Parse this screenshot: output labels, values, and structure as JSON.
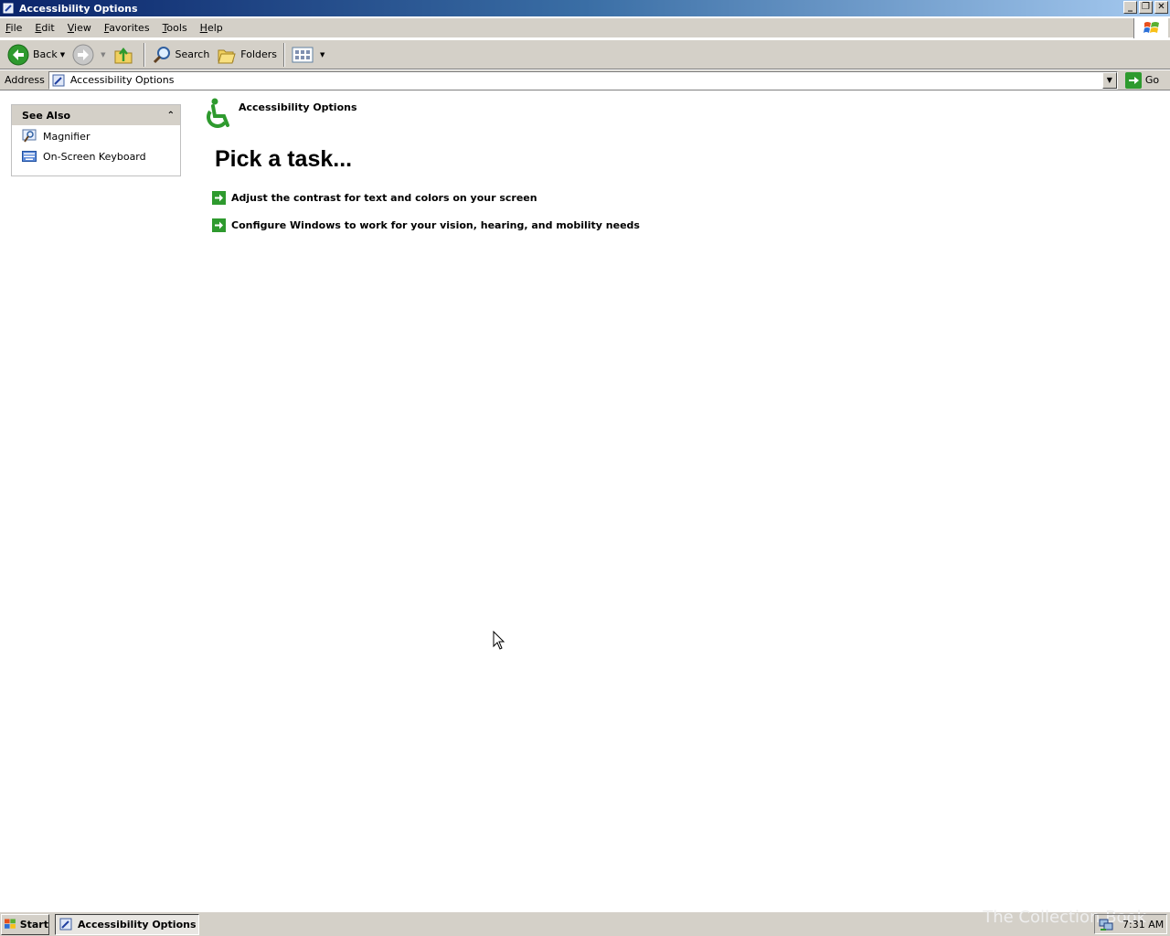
{
  "window": {
    "title": "Accessibility Options"
  },
  "menubar": {
    "items": [
      {
        "key": "F",
        "rest": "ile"
      },
      {
        "key": "E",
        "rest": "dit"
      },
      {
        "key": "V",
        "rest": "iew"
      },
      {
        "key": "F",
        "rest": "avorites",
        "prefix": ""
      },
      {
        "key": "T",
        "rest": "ools"
      },
      {
        "key": "H",
        "rest": "elp"
      }
    ]
  },
  "toolbar": {
    "back_label": "Back",
    "search_label": "Search",
    "folders_label": "Folders"
  },
  "address": {
    "label": "Address",
    "value": "Accessibility Options",
    "go_label": "Go"
  },
  "see_also": {
    "title": "See Also",
    "items": [
      {
        "label": "Magnifier"
      },
      {
        "label": "On-Screen Keyboard"
      }
    ]
  },
  "main": {
    "category_title": "Accessibility Options",
    "pick_title": "Pick a task...",
    "tasks": [
      {
        "label": "Adjust the contrast for text and colors on your screen"
      },
      {
        "label": "Configure Windows to work for your vision, hearing, and mobility needs"
      }
    ]
  },
  "taskbar": {
    "start_label": "Start",
    "active_task": "Accessibility Options",
    "clock": "7:31 AM",
    "watermark": "The Collection Book"
  },
  "colors": {
    "titlebar_start": "#0a246a",
    "titlebar_end": "#a6caf0",
    "chrome": "#d4d0c8",
    "task_arrow": "#2e9a2e"
  }
}
